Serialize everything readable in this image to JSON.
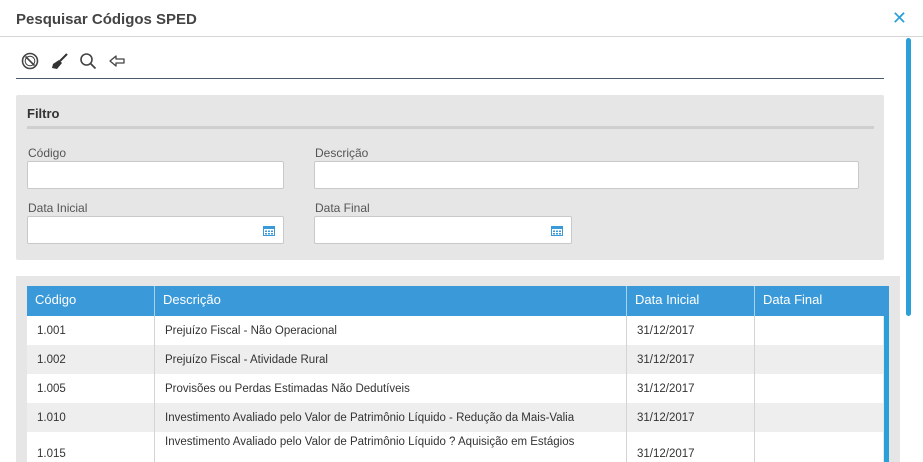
{
  "window": {
    "title": "Pesquisar Códigos SPED",
    "close_glyph": "✕"
  },
  "toolbar": {
    "buttons": [
      {
        "name": "cancel-button",
        "icon": "prohibit-icon"
      },
      {
        "name": "clear-button",
        "icon": "broom-icon"
      },
      {
        "name": "search-button",
        "icon": "magnifier-icon"
      },
      {
        "name": "back-button",
        "icon": "arrow-left-icon"
      }
    ]
  },
  "filter": {
    "title": "Filtro",
    "codigo_label": "Código",
    "codigo_value": "",
    "descricao_label": "Descrição",
    "descricao_value": "",
    "data_inicial_label": "Data Inicial",
    "data_inicial_value": "",
    "data_final_label": "Data Final",
    "data_final_value": ""
  },
  "table": {
    "headers": [
      "Código",
      "Descrição",
      "Data Inicial",
      "Data Final"
    ],
    "rows": [
      {
        "codigo": "1.001",
        "descricao": "Prejuízo Fiscal - Não Operacional",
        "data_inicial": "31/12/2017",
        "data_final": ""
      },
      {
        "codigo": "1.002",
        "descricao": "Prejuízo Fiscal - Atividade Rural",
        "data_inicial": "31/12/2017",
        "data_final": ""
      },
      {
        "codigo": "1.005",
        "descricao": "Provisões ou Perdas Estimadas Não Dedutíveis",
        "data_inicial": "31/12/2017",
        "data_final": ""
      },
      {
        "codigo": "1.010",
        "descricao": "Investimento Avaliado pelo Valor de Patrimônio Líquido - Redução da Mais-Valia",
        "data_inicial": "31/12/2017",
        "data_final": ""
      },
      {
        "codigo": "1.015",
        "descricao": "Investimento Avaliado pelo Valor de Patrimônio Líquido ? Aquisição em Estágios",
        "data_inicial": "31/12/2017",
        "data_final": ""
      }
    ]
  },
  "colors": {
    "accent": "#2a9fd8",
    "header": "#3a9ad9",
    "panel": "#e6e6e6",
    "row_alt": "#eeeeee"
  }
}
